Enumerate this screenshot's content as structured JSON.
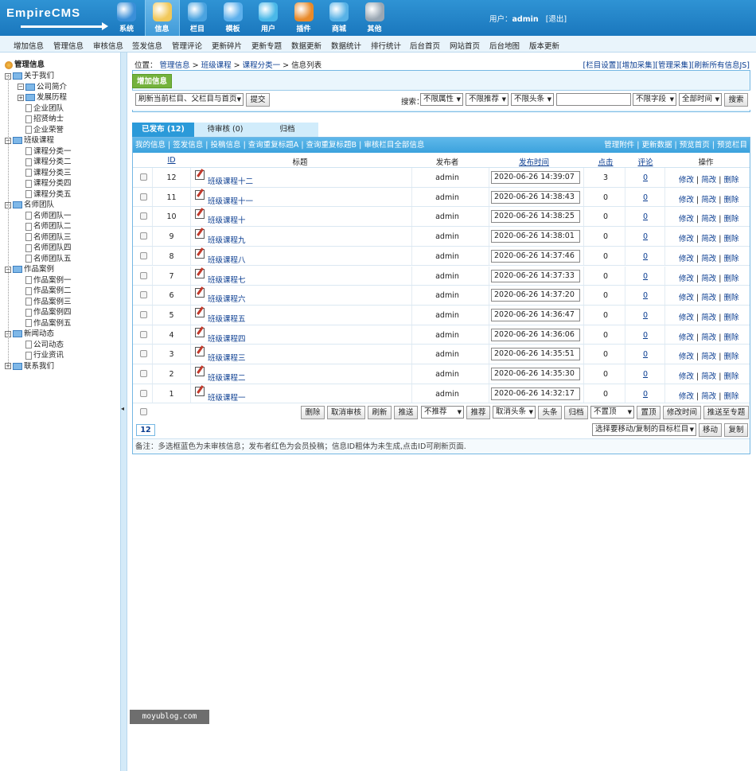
{
  "header": {
    "logo": "EmpireCMS",
    "nav": [
      {
        "label": "系统",
        "color": "#3a8fd8"
      },
      {
        "label": "信息",
        "color": "#f1c85a"
      },
      {
        "label": "栏目",
        "color": "#4aa3e0"
      },
      {
        "label": "模板",
        "color": "#5db0ec"
      },
      {
        "label": "用户",
        "color": "#4ab8e8"
      },
      {
        "label": "插件",
        "color": "#e88a2a"
      },
      {
        "label": "商城",
        "color": "#58b2e6"
      },
      {
        "label": "其他",
        "color": "#9aa7b3"
      }
    ],
    "active_nav": "信息",
    "user_label": "用户：",
    "username": "admin",
    "logout": "[退出]"
  },
  "subnav": [
    "增加信息",
    "管理信息",
    "审核信息",
    "签发信息",
    "管理评论",
    "更新碎片",
    "更新专题",
    "数据更新",
    "数据统计",
    "排行统计",
    "后台首页",
    "网站首页",
    "后台地图",
    "版本更新"
  ],
  "tree": {
    "root": "管理信息",
    "nodes": [
      {
        "label": "关于我们",
        "level": 0,
        "type": "folder",
        "sign": "−"
      },
      {
        "label": "公司简介",
        "level": 1,
        "type": "folder",
        "sign": "−"
      },
      {
        "label": "发展历程",
        "level": 1,
        "type": "folder",
        "sign": "+"
      },
      {
        "label": "企业团队",
        "level": 1,
        "type": "page"
      },
      {
        "label": "招贤纳士",
        "level": 1,
        "type": "page"
      },
      {
        "label": "企业荣誉",
        "level": 1,
        "type": "page"
      },
      {
        "label": "班级课程",
        "level": 0,
        "type": "folder",
        "sign": "−"
      },
      {
        "label": "课程分类一",
        "level": 1,
        "type": "page"
      },
      {
        "label": "课程分类二",
        "level": 1,
        "type": "page"
      },
      {
        "label": "课程分类三",
        "level": 1,
        "type": "page"
      },
      {
        "label": "课程分类四",
        "level": 1,
        "type": "page"
      },
      {
        "label": "课程分类五",
        "level": 1,
        "type": "page"
      },
      {
        "label": "名师团队",
        "level": 0,
        "type": "folder",
        "sign": "−"
      },
      {
        "label": "名师团队一",
        "level": 1,
        "type": "page"
      },
      {
        "label": "名师团队二",
        "level": 1,
        "type": "page"
      },
      {
        "label": "名师团队三",
        "level": 1,
        "type": "page"
      },
      {
        "label": "名师团队四",
        "level": 1,
        "type": "page"
      },
      {
        "label": "名师团队五",
        "level": 1,
        "type": "page"
      },
      {
        "label": "作品案例",
        "level": 0,
        "type": "folder",
        "sign": "−"
      },
      {
        "label": "作品案例一",
        "level": 1,
        "type": "page"
      },
      {
        "label": "作品案例二",
        "level": 1,
        "type": "page"
      },
      {
        "label": "作品案例三",
        "level": 1,
        "type": "page"
      },
      {
        "label": "作品案例四",
        "level": 1,
        "type": "page"
      },
      {
        "label": "作品案例五",
        "level": 1,
        "type": "page"
      },
      {
        "label": "新闻动态",
        "level": 0,
        "type": "folder",
        "sign": "−"
      },
      {
        "label": "公司动态",
        "level": 1,
        "type": "page"
      },
      {
        "label": "行业资讯",
        "level": 1,
        "type": "page"
      },
      {
        "label": "联系我们",
        "level": 0,
        "type": "folder",
        "sign": "+"
      }
    ]
  },
  "breadcrumb": {
    "prefix": "位置：",
    "items": [
      "管理信息",
      "班级课程",
      "课程分类一"
    ],
    "current": "信息列表",
    "sep": " > "
  },
  "top_links": [
    "[栏目设置]",
    "[增加采集]",
    "[管理采集]",
    "[刷新所有信息JS]"
  ],
  "toolbar": {
    "add_button": "增加信息",
    "refresh_select": "刷新当前栏目、父栏目与首页",
    "submit": "提交",
    "search_label": "搜索：",
    "filter_attr": "不限属性",
    "filter_recommend": "不限推荐",
    "filter_headline": "不限头条",
    "search_value": "",
    "filter_field": "不限字段",
    "filter_time": "全部时间",
    "search_button": "搜索"
  },
  "tabs": [
    "已发布 (12)",
    "待审核 (0)",
    "归档"
  ],
  "link_bar": {
    "left": [
      "我的信息",
      "签发信息",
      "投稿信息",
      "查询重复标题A",
      "查询重复标题B",
      "审核栏目全部信息"
    ],
    "right": [
      "管理附件",
      "更新数据",
      "预览首页",
      "预览栏目"
    ]
  },
  "columns": [
    "ID",
    "标题",
    "发布者",
    "发布时间",
    "点击",
    "评论",
    "操作"
  ],
  "rows": [
    {
      "id": "12",
      "title": "班级课程十二",
      "author": "admin",
      "time": "2020-06-26 14:39:07",
      "clicks": "3",
      "comments": "0"
    },
    {
      "id": "11",
      "title": "班级课程十一",
      "author": "admin",
      "time": "2020-06-26 14:38:43",
      "clicks": "0",
      "comments": "0"
    },
    {
      "id": "10",
      "title": "班级课程十",
      "author": "admin",
      "time": "2020-06-26 14:38:25",
      "clicks": "0",
      "comments": "0"
    },
    {
      "id": "9",
      "title": "班级课程九",
      "author": "admin",
      "time": "2020-06-26 14:38:01",
      "clicks": "0",
      "comments": "0"
    },
    {
      "id": "8",
      "title": "班级课程八",
      "author": "admin",
      "time": "2020-06-26 14:37:46",
      "clicks": "0",
      "comments": "0"
    },
    {
      "id": "7",
      "title": "班级课程七",
      "author": "admin",
      "time": "2020-06-26 14:37:33",
      "clicks": "0",
      "comments": "0"
    },
    {
      "id": "6",
      "title": "班级课程六",
      "author": "admin",
      "time": "2020-06-26 14:37:20",
      "clicks": "0",
      "comments": "0"
    },
    {
      "id": "5",
      "title": "班级课程五",
      "author": "admin",
      "time": "2020-06-26 14:36:47",
      "clicks": "0",
      "comments": "0"
    },
    {
      "id": "4",
      "title": "班级课程四",
      "author": "admin",
      "time": "2020-06-26 14:36:06",
      "clicks": "0",
      "comments": "0"
    },
    {
      "id": "3",
      "title": "班级课程三",
      "author": "admin",
      "time": "2020-06-26 14:35:51",
      "clicks": "0",
      "comments": "0"
    },
    {
      "id": "2",
      "title": "班级课程二",
      "author": "admin",
      "time": "2020-06-26 14:35:30",
      "clicks": "0",
      "comments": "0"
    },
    {
      "id": "1",
      "title": "班级课程一",
      "author": "admin",
      "time": "2020-06-26 14:32:17",
      "clicks": "0",
      "comments": "0"
    }
  ],
  "row_ops": [
    "修改",
    "简改",
    "删除"
  ],
  "bulk_actions": {
    "delete": "删除",
    "unaudit": "取消审核",
    "refresh": "刷新",
    "push": "推送",
    "recommend_select": "不推荐",
    "recommend": "推荐",
    "headline_select": "取消头条",
    "headline": "头条",
    "archive": "归档",
    "top_select": "不置顶",
    "top": "置顶",
    "modify_time": "修改时间",
    "push_topic": "推送至专题"
  },
  "pagination": {
    "current": "12"
  },
  "move": {
    "target_select": "选择要移动/复制的目标栏目",
    "move": "移动",
    "copy": "复制"
  },
  "note": "备注：多选框蓝色为未审核信息；发布者红色为会员投稿；信息ID粗体为未生成,点击ID可刷新页面.",
  "watermark": "moyublog.com"
}
